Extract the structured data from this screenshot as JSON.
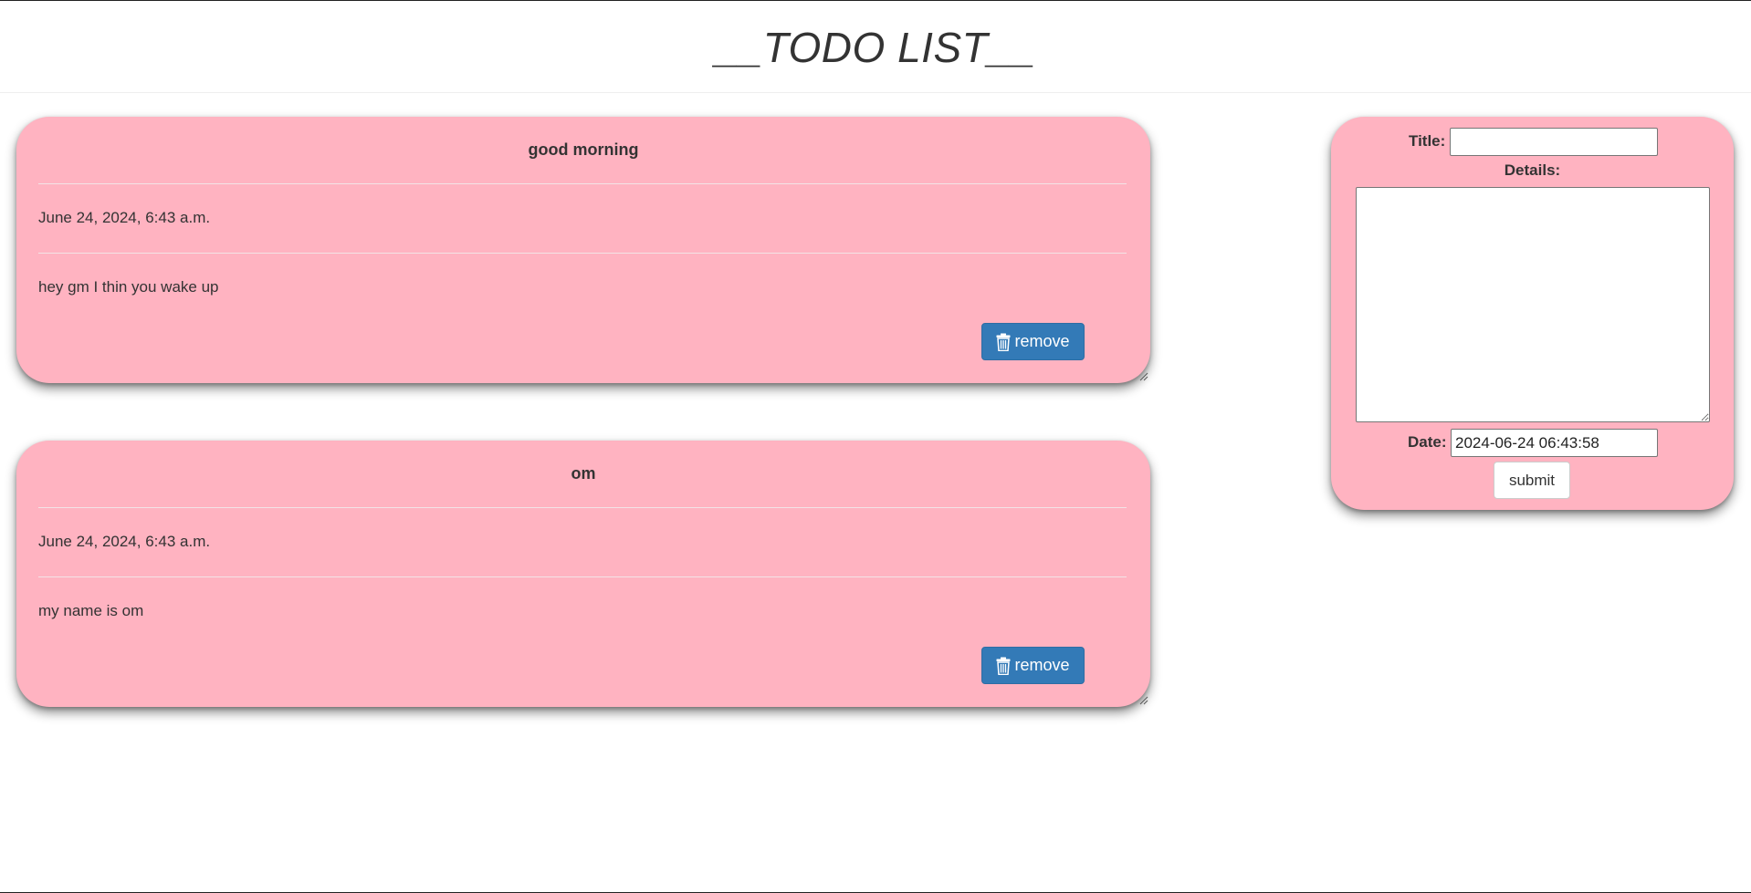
{
  "header": {
    "title": "__TODO LIST__"
  },
  "todos": [
    {
      "title": "good morning",
      "date": "June 24, 2024, 6:43 a.m.",
      "details": "hey gm I thin you wake up",
      "remove_label": "remove"
    },
    {
      "title": "om",
      "date": "June 24, 2024, 6:43 a.m.",
      "details": "my name is om",
      "remove_label": "remove"
    }
  ],
  "form": {
    "title_label": "Title:",
    "title_value": "",
    "details_label": "Details:",
    "details_value": "",
    "date_label": "Date:",
    "date_value": "2024-06-24 06:43:58",
    "submit_label": "submit"
  },
  "icons": {
    "remove_icon": "trash-icon"
  },
  "colors": {
    "card_background": "#ffb3c1",
    "remove_button": "#337ab7",
    "text": "#333333"
  }
}
